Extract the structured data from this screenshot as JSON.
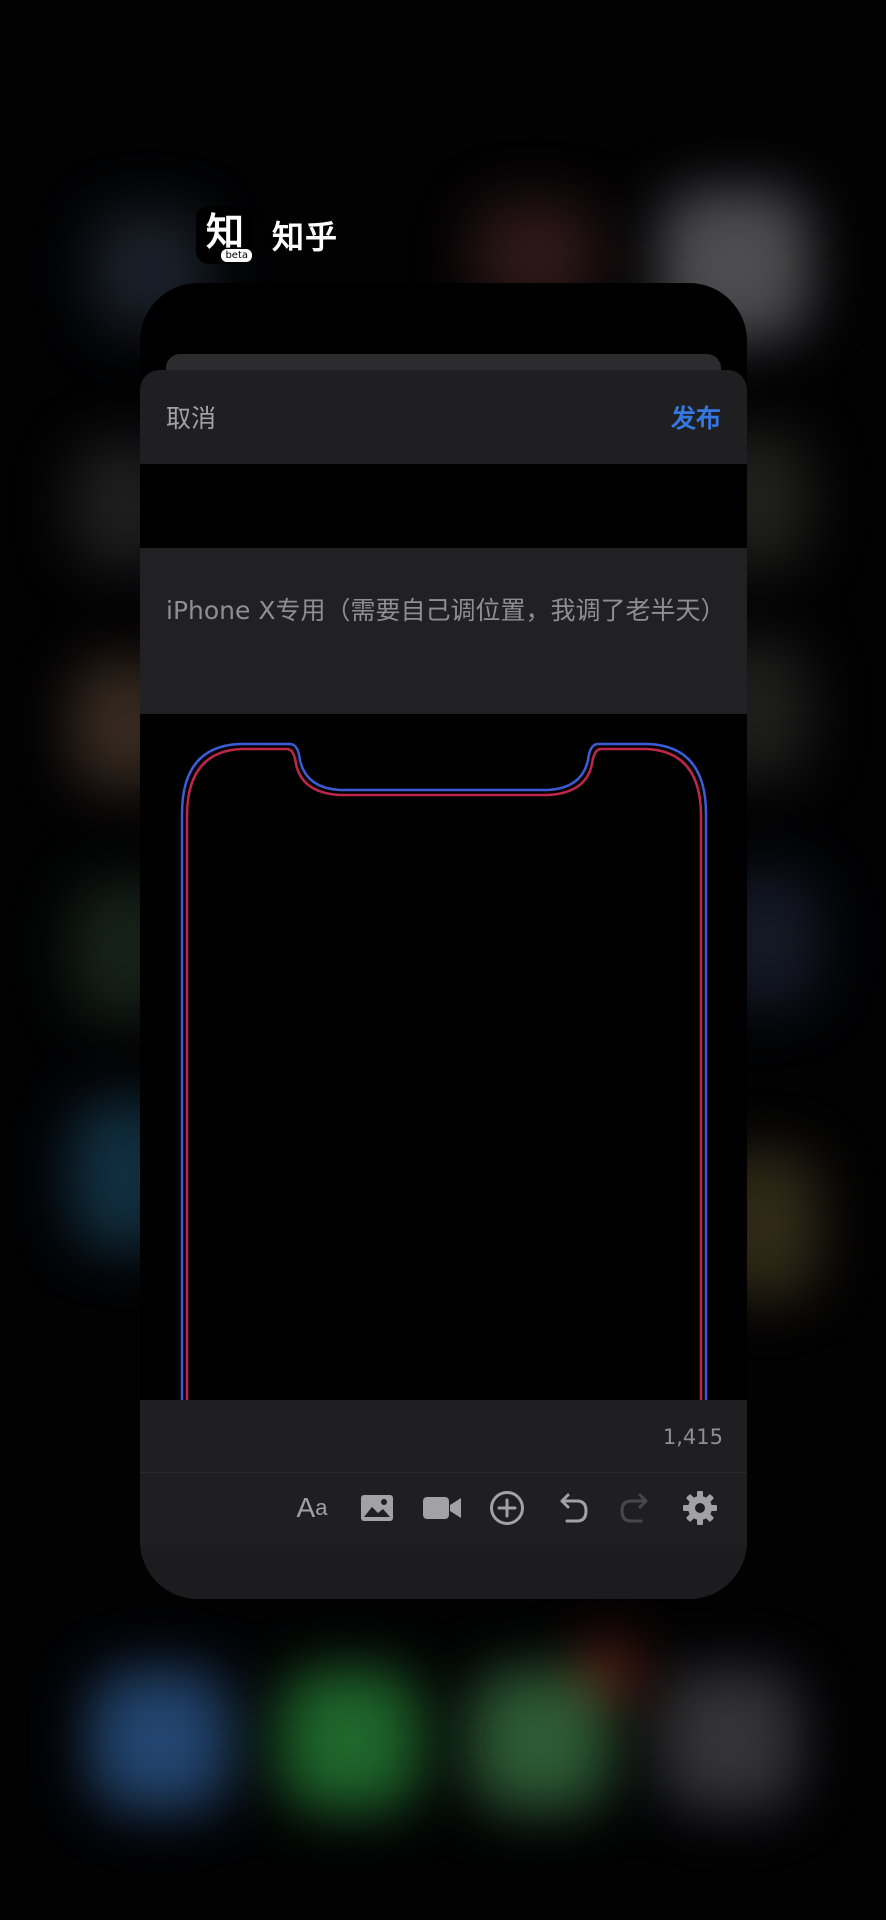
{
  "app": {
    "name": "知乎",
    "icon_glyph": "知",
    "icon_badge": "beta"
  },
  "nav": {
    "cancel_label": "取消",
    "publish_label": "发布",
    "publish_color": "#3478e0"
  },
  "post": {
    "body": "iPhone X专用（需要自己调位置，我调了老半天）"
  },
  "image": {
    "description_icon": "iphone-x-outline-wallpaper",
    "outline_colors": [
      "#3d5bd6",
      "#c0264a"
    ]
  },
  "editor": {
    "char_count": "1,415",
    "toolbar": {
      "format_label_big": "A",
      "format_label_small": "a",
      "icons": [
        "text-format-icon",
        "image-icon",
        "video-icon",
        "add-circle-icon",
        "undo-icon",
        "redo-icon",
        "settings-icon"
      ]
    }
  }
}
